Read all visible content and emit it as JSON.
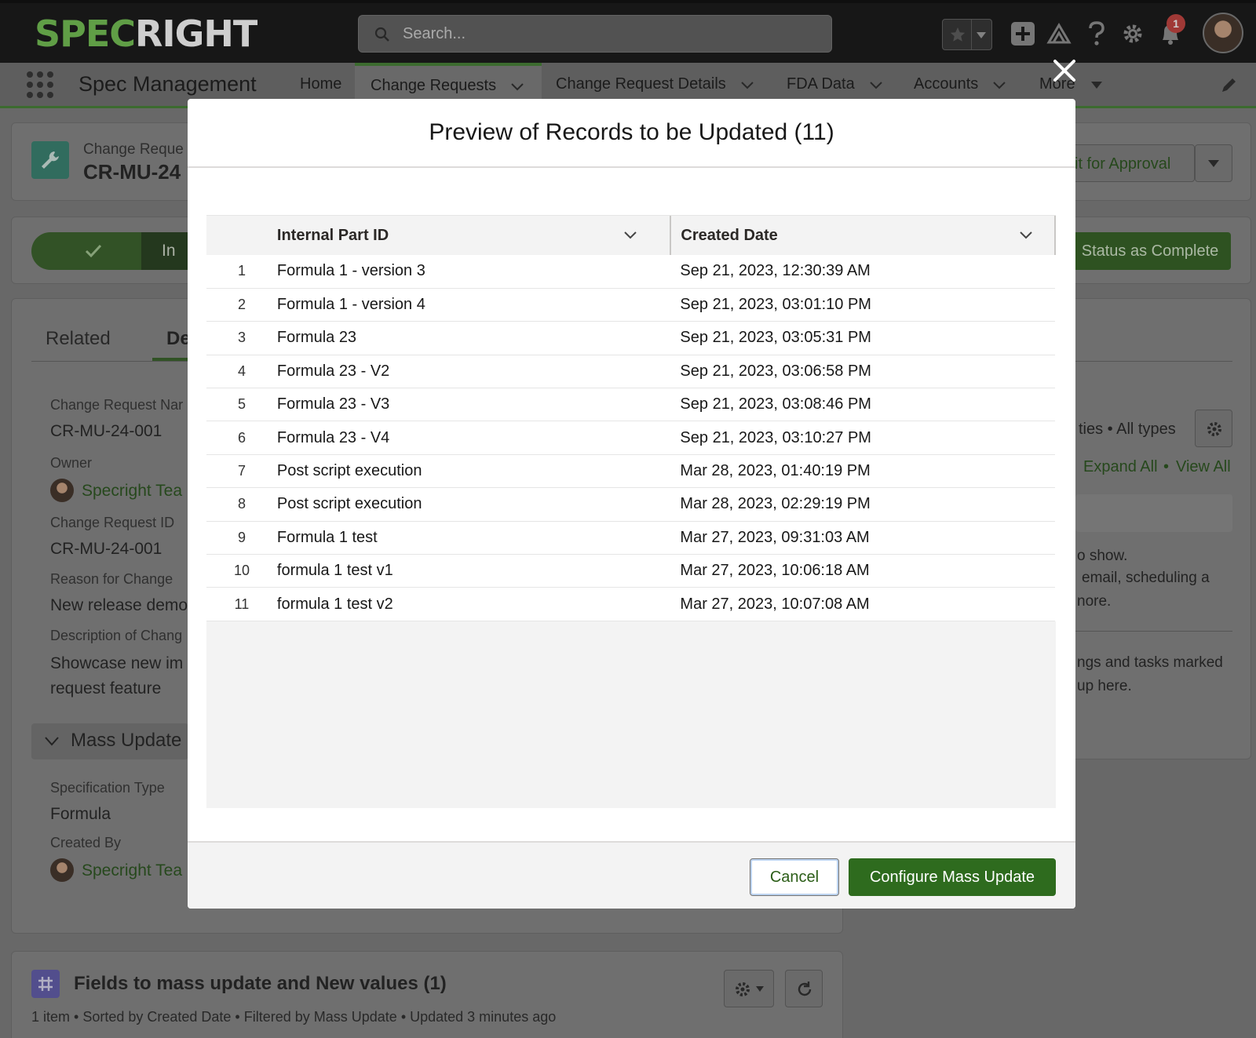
{
  "header": {
    "logo_part1": "SPEC",
    "logo_part2": "RIGHT",
    "search_placeholder": "Search...",
    "notification_count": "1"
  },
  "nav": {
    "app_name": "Spec Management",
    "items": [
      {
        "label": "Home"
      },
      {
        "label": "Change Requests"
      },
      {
        "label": "Change Request Details"
      },
      {
        "label": "FDA Data"
      },
      {
        "label": "Accounts"
      },
      {
        "label": "More"
      }
    ]
  },
  "background": {
    "record_type": "Change Reque",
    "record_name": "CR-MU-24",
    "submit_button": "it for Approval",
    "path_current": "In",
    "mark_status_button": "Status as Complete",
    "tabs": [
      "Related",
      "De"
    ],
    "fields": [
      {
        "label": "Change Request Nar",
        "value": "CR-MU-24-001"
      },
      {
        "label": "Owner",
        "value": "Specright Tea"
      },
      {
        "label": "Change Request ID",
        "value": "CR-MU-24-001"
      },
      {
        "label": "Reason for Change",
        "value": "New release demo"
      },
      {
        "label": "Description of Chang",
        "value": "Showcase new im"
      },
      {
        "label": "",
        "value": "request feature"
      }
    ],
    "section_title": "Mass Update",
    "fields2": [
      {
        "label": "Specification Type",
        "value": "Formula"
      },
      {
        "label": "Created By",
        "value": "Specright Tea"
      }
    ],
    "activity": {
      "filter_text": "ties • All types",
      "expand_all": "Expand All",
      "view_all": "View All",
      "empty1": "o show.",
      "empty2": "email, scheduling a",
      "empty3": "nore.",
      "empty4": "ngs and tasks marked",
      "empty5": "up here."
    },
    "related_list": {
      "title": "Fields to mass update and New values (1)",
      "meta": "1 item • Sorted by Created Date • Filtered by Mass Update • Updated 3 minutes ago"
    }
  },
  "modal": {
    "title": "Preview of Records to be Updated (11)",
    "columns": [
      "Internal Part ID",
      "Created Date"
    ],
    "rows": [
      {
        "num": "1",
        "part": "Formula 1 - version 3",
        "date": "Sep 21, 2023, 12:30:39 AM"
      },
      {
        "num": "2",
        "part": "Formula 1 - version 4",
        "date": "Sep 21, 2023, 03:01:10 PM"
      },
      {
        "num": "3",
        "part": "Formula 23",
        "date": "Sep 21, 2023, 03:05:31 PM"
      },
      {
        "num": "4",
        "part": "Formula 23 - V2",
        "date": "Sep 21, 2023, 03:06:58 PM"
      },
      {
        "num": "5",
        "part": "Formula 23 - V3",
        "date": "Sep 21, 2023, 03:08:46 PM"
      },
      {
        "num": "6",
        "part": "Formula 23 - V4",
        "date": "Sep 21, 2023, 03:10:27 PM"
      },
      {
        "num": "7",
        "part": "Post script execution",
        "date": "Mar 28, 2023, 01:40:19 PM"
      },
      {
        "num": "8",
        "part": "Post script execution",
        "date": "Mar 28, 2023, 02:29:19 PM"
      },
      {
        "num": "9",
        "part": "Formula 1 test",
        "date": "Mar 27, 2023, 09:31:03 AM"
      },
      {
        "num": "10",
        "part": "formula 1 test v1",
        "date": "Mar 27, 2023, 10:06:18 AM"
      },
      {
        "num": "11",
        "part": "formula 1 test v2",
        "date": "Mar 27, 2023, 10:07:08 AM"
      }
    ],
    "cancel_label": "Cancel",
    "configure_label": "Configure Mass Update"
  },
  "colors": {
    "brand_green": "#6cbf4a",
    "primary_button": "#2e6b1e",
    "header_bg": "#0b0b0b"
  }
}
